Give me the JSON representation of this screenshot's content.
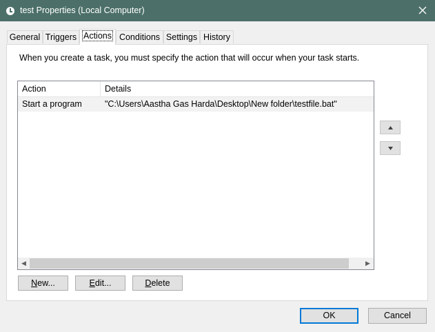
{
  "window": {
    "title": "test Properties (Local Computer)",
    "title_icon": "clock-icon",
    "close_icon": "close-icon"
  },
  "tabs": [
    {
      "label": "General"
    },
    {
      "label": "Triggers"
    },
    {
      "label": "Actions",
      "selected": true
    },
    {
      "label": "Conditions"
    },
    {
      "label": "Settings"
    },
    {
      "label": "History"
    }
  ],
  "description": "When you create a task, you must specify the action that will occur when your task starts.",
  "actions_list": {
    "columns": [
      "Action",
      "Details"
    ],
    "rows": [
      {
        "action": "Start a program",
        "details": "\"C:\\Users\\Aastha Gas Harda\\Desktop\\New folder\\testfile.bat\""
      }
    ]
  },
  "move_up_icon": "triangle-up-icon",
  "move_down_icon": "triangle-down-icon",
  "buttons": {
    "new": {
      "pre": "",
      "key": "N",
      "post": "ew..."
    },
    "edit": {
      "pre": "",
      "key": "E",
      "post": "dit..."
    },
    "delete": {
      "pre": "",
      "key": "D",
      "post": "elete"
    },
    "ok": "OK",
    "cancel": "Cancel"
  },
  "colors": {
    "titlebar": "#4c7069",
    "accent": "#0078d7"
  }
}
